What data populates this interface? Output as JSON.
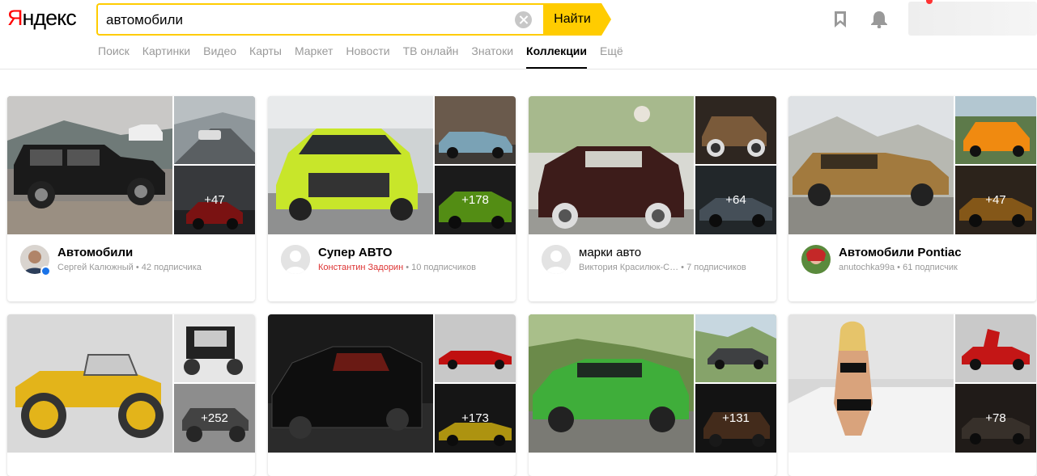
{
  "logo": "Яндекс",
  "search": {
    "value": "автомобили",
    "button": "Найти"
  },
  "nav": [
    "Поиск",
    "Картинки",
    "Видео",
    "Карты",
    "Маркет",
    "Новости",
    "ТВ онлайн",
    "Знатоки",
    "Коллекции",
    "Ещё"
  ],
  "nav_active": "Коллекции",
  "cards": [
    {
      "title": "Автомобили",
      "author": "Сергей Калюжный",
      "subs": "42 подписчика",
      "more": "+47",
      "verified": true
    },
    {
      "title": "Супер АВТО",
      "author": "Константин Задорин",
      "subs": "10 подписчиков",
      "more": "+178"
    },
    {
      "title": "марки авто",
      "author": "Виктория Красилюк-С…",
      "subs": "7 подписчиков",
      "more": "+64"
    },
    {
      "title": "Автомобили Pontiac",
      "author": "anutochka99a",
      "subs": "61 подписчик",
      "more": "+47"
    },
    {
      "more": "+252"
    },
    {
      "more": "+173"
    },
    {
      "more": "+131"
    },
    {
      "more": "+78"
    }
  ]
}
